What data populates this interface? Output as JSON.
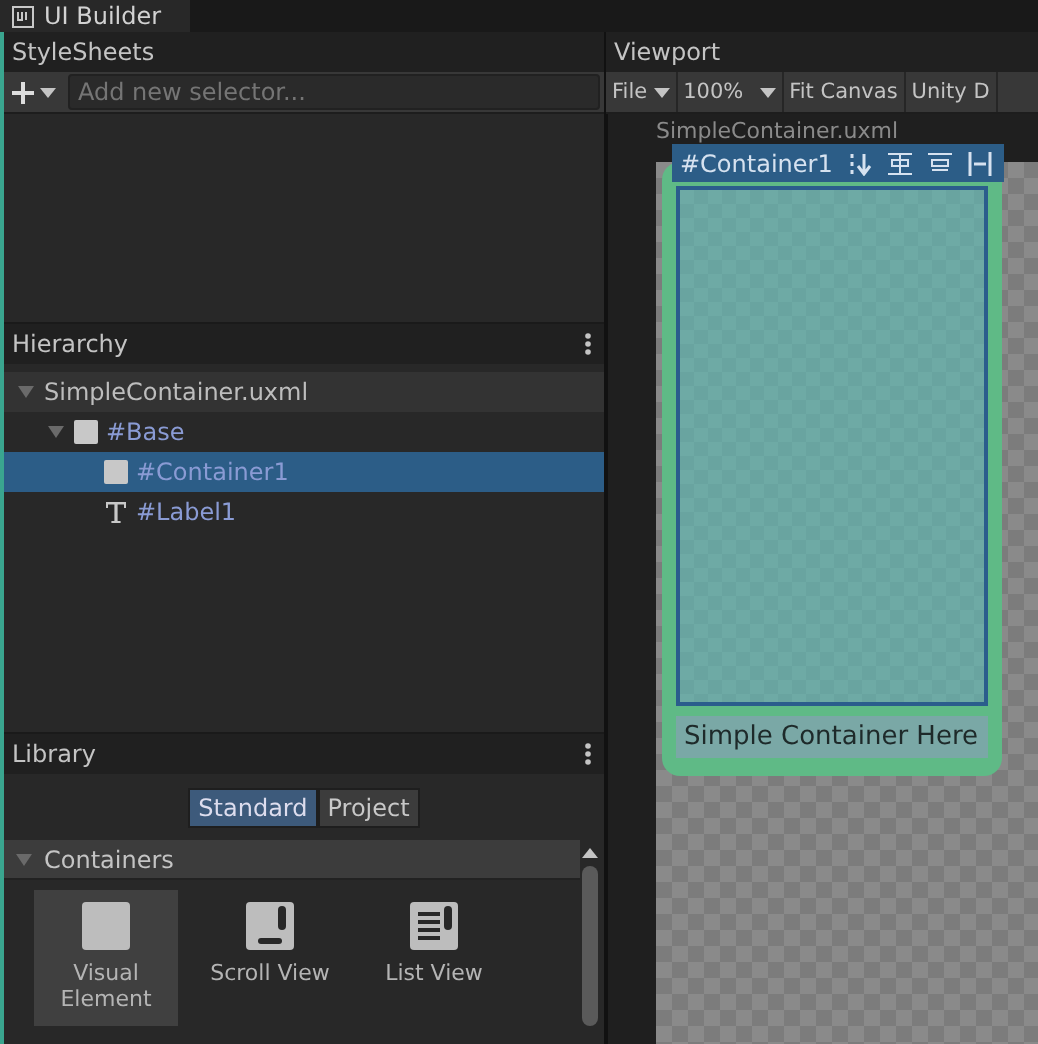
{
  "tab": {
    "title": "UI Builder"
  },
  "stylesheets": {
    "title": "StyleSheets",
    "selector_placeholder": "Add new selector..."
  },
  "hierarchy": {
    "title": "Hierarchy",
    "items": [
      {
        "label": "SimpleContainer.uxml",
        "kind": "file",
        "expanded": true,
        "selected": false,
        "children": [
          {
            "label": "#Base",
            "kind": "element",
            "expanded": true,
            "selected": false,
            "children": [
              {
                "label": "#Container1",
                "kind": "element",
                "selected": true
              },
              {
                "label": "#Label1",
                "kind": "label",
                "selected": false
              }
            ]
          }
        ]
      }
    ]
  },
  "library": {
    "title": "Library",
    "tabs": [
      {
        "label": "Standard",
        "selected": true
      },
      {
        "label": "Project",
        "selected": false
      }
    ],
    "section": {
      "title": "Containers",
      "expanded": true,
      "items": [
        {
          "label": "Visual Element",
          "kind": "visual-element",
          "selected": true
        },
        {
          "label": "Scroll View",
          "kind": "scroll-view",
          "selected": false
        },
        {
          "label": "List View",
          "kind": "list-view",
          "selected": false
        }
      ]
    }
  },
  "viewport": {
    "title": "Viewport",
    "toolbar": [
      {
        "label": "File",
        "kind": "menu"
      },
      {
        "label": "100%",
        "kind": "menu"
      },
      {
        "label": "Fit Canvas",
        "kind": "button"
      },
      {
        "label": "Unity D",
        "kind": "button"
      }
    ],
    "document": "SimpleContainer.uxml",
    "selection_badge": "#Container1",
    "label_text": "Simple Container Here"
  }
}
